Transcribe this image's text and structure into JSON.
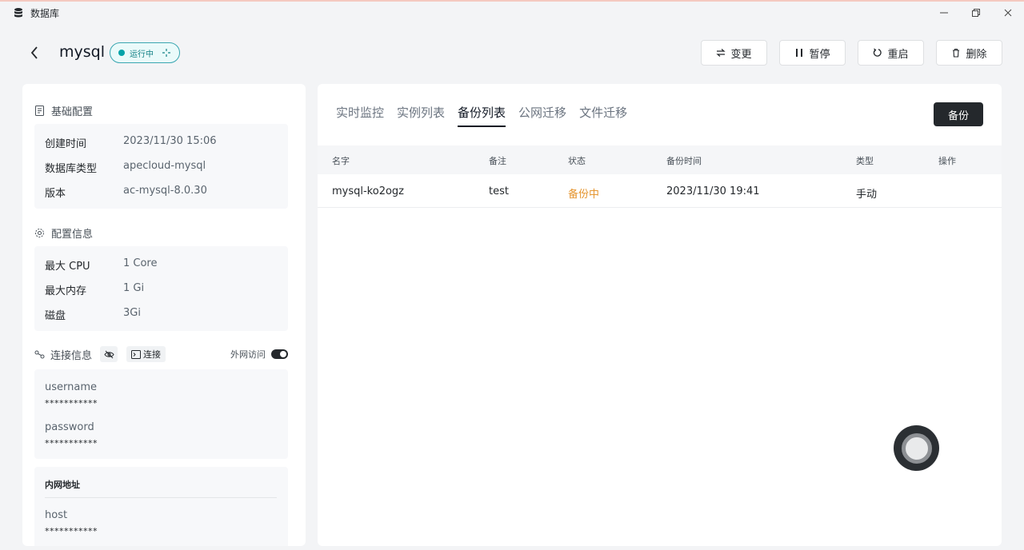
{
  "window": {
    "title": "数据库",
    "controls": {
      "minimize": "—",
      "restore": "❐",
      "close": "✕"
    }
  },
  "header": {
    "db_name": "mysql",
    "status": "运行中",
    "actions": [
      {
        "label": "变更",
        "icon": "swap-icon"
      },
      {
        "label": "暂停",
        "icon": "pause-icon"
      },
      {
        "label": "重启",
        "icon": "restart-icon"
      },
      {
        "label": "删除",
        "icon": "trash-icon"
      }
    ]
  },
  "basic": {
    "title": "基础配置",
    "rows": [
      {
        "key": "创建时间",
        "value": "2023/11/30 15:06"
      },
      {
        "key": "数据库类型",
        "value": "apecloud-mysql"
      },
      {
        "key": "版本",
        "value": "ac-mysql-8.0.30"
      }
    ]
  },
  "config": {
    "title": "配置信息",
    "rows": [
      {
        "key": "最大 CPU",
        "value": "1 Core"
      },
      {
        "key": "最大内存",
        "value": "1 Gi"
      },
      {
        "key": "磁盘",
        "value": "3Gi"
      }
    ]
  },
  "connection": {
    "title": "连接信息",
    "connect_label": "连接",
    "external_label": "外网访问",
    "external_enabled": true,
    "username_label": "username",
    "username_value": "***********",
    "password_label": "password",
    "password_value": "***********",
    "lan_title": "内网地址",
    "host_label": "host",
    "host_value": "***********"
  },
  "tabs": [
    "实时监控",
    "实例列表",
    "备份列表",
    "公网迁移",
    "文件迁移"
  ],
  "active_tab": "备份列表",
  "backup_button": "备份",
  "table": {
    "headers": [
      "名字",
      "备注",
      "状态",
      "备份时间",
      "类型",
      "操作"
    ],
    "rows": [
      {
        "name": "mysql-ko2ogz",
        "remark": "test",
        "status": "备份中",
        "time": "2023/11/30 19:41",
        "type": "手动",
        "ops": ""
      }
    ]
  },
  "colors": {
    "accent": "#24282c",
    "running": "#03a3a9",
    "in_progress": "#e5952f"
  }
}
